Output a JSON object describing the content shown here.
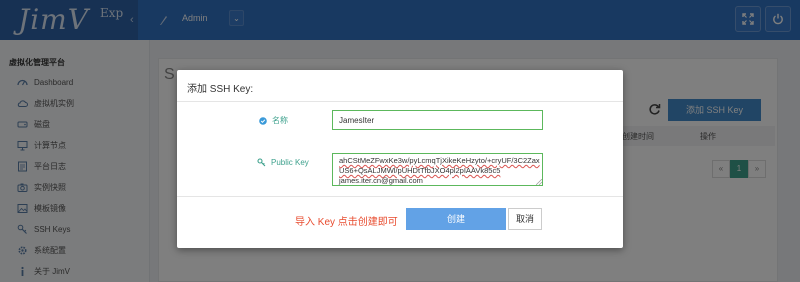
{
  "app": {
    "logo": "JimV",
    "logo_sup": "Exp",
    "user": "Admin"
  },
  "sidebar": {
    "title": "虚拟化管理平台",
    "items": [
      {
        "label": "Dashboard",
        "icon": "dashboard-icon"
      },
      {
        "label": "虚拟机实例",
        "icon": "cloud-icon"
      },
      {
        "label": "磁盘",
        "icon": "disk-icon"
      },
      {
        "label": "计算节点",
        "icon": "monitor-icon"
      },
      {
        "label": "平台日志",
        "icon": "log-icon"
      },
      {
        "label": "实例快照",
        "icon": "camera-icon"
      },
      {
        "label": "模板镜像",
        "icon": "image-icon"
      },
      {
        "label": "SSH Keys",
        "icon": "key-icon"
      },
      {
        "label": "系统配置",
        "icon": "gear-icon"
      },
      {
        "label": "关于 JimV",
        "icon": "info-icon"
      }
    ]
  },
  "main": {
    "heading_partial": "S",
    "add_ssh_key_button": "添加 SSH Key",
    "table": {
      "col_create_time": "创建时间",
      "col_action": "操作"
    },
    "pagination": {
      "prev": "«",
      "current": "1",
      "next": "»"
    }
  },
  "modal": {
    "title": "添加 SSH Key:",
    "name_label": "名称",
    "name_value": "JamesIter",
    "key_label": "Public Key",
    "key_lines": [
      "ahCStMeZFwxKe3w/pyLcmqTjXikeKeHzyto/+cryUF/3C2Zax",
      "US6+QsALJMWl/pUHDtTfbJXO4pl2pIAAVk85c5",
      "james.iter.cn@gmail.com"
    ],
    "hint": "导入 Key 点击创建即可",
    "create_button": "创建",
    "cancel_button": "取消"
  },
  "colors": {
    "topbar": "#3073c3",
    "accent_green": "#3ea18d",
    "input_border": "#5cb85c",
    "primary_button": "#62a2e6",
    "hint_red": "#e84b2e"
  }
}
